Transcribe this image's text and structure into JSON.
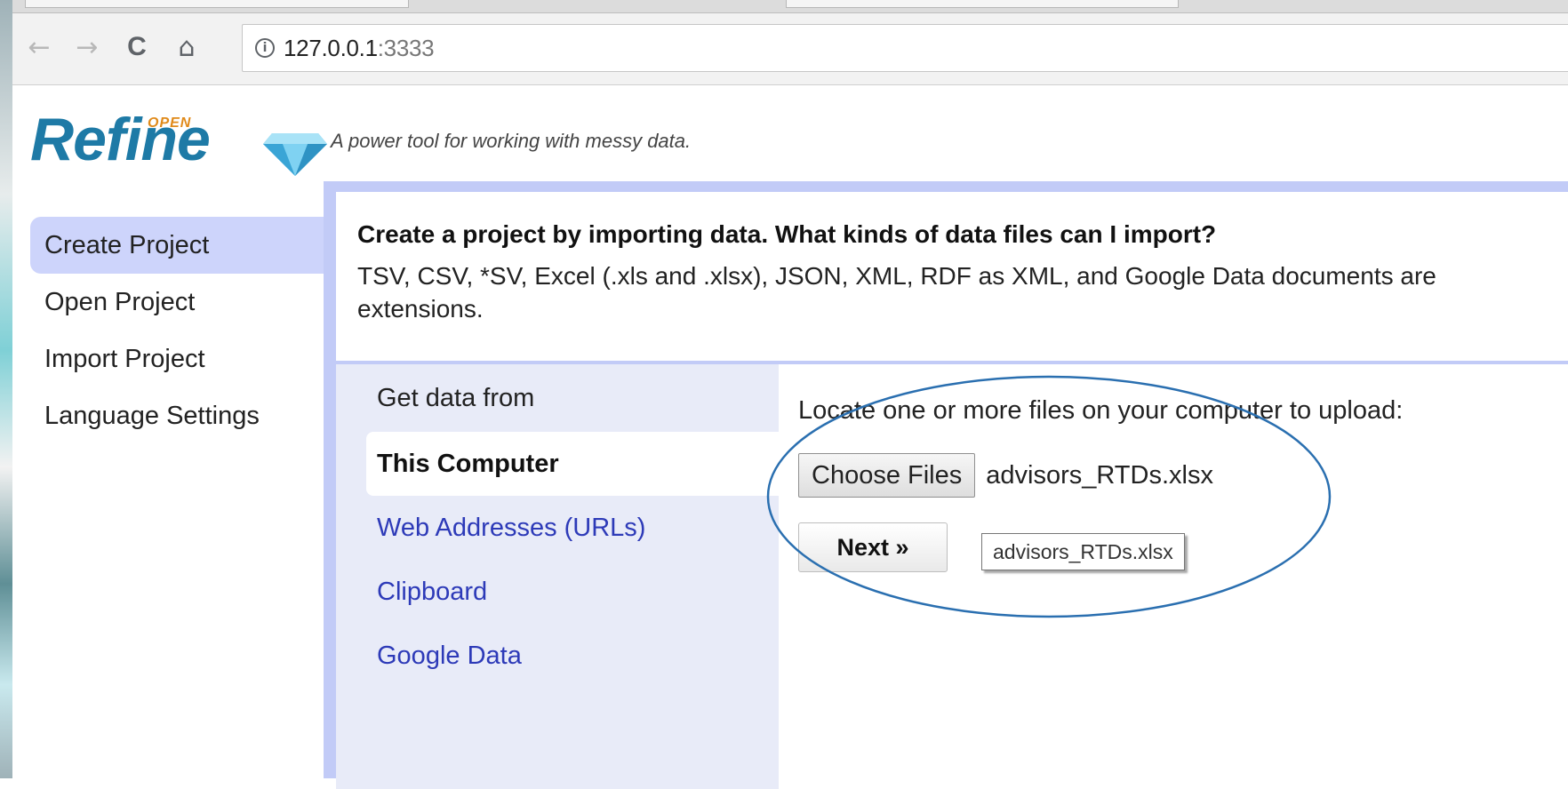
{
  "browser": {
    "back_icon": "←",
    "forward_icon": "→",
    "reload_icon": "C",
    "home_icon": "⌂",
    "url_host": "127.0.0.1",
    "url_port": ":3333"
  },
  "header": {
    "logo_text": "Refine",
    "logo_superscript": "OPEN",
    "tagline": "A power tool for working with messy data."
  },
  "left_nav": {
    "items": [
      {
        "label": "Create Project"
      },
      {
        "label": "Open Project"
      },
      {
        "label": "Import Project"
      },
      {
        "label": "Language Settings"
      }
    ]
  },
  "main": {
    "title": "Create a project by importing data. What kinds of data files can I import?",
    "description": "TSV, CSV, *SV, Excel (.xls and .xlsx), JSON, XML, RDF as XML, and Google Data documents are\nextensions."
  },
  "sources": {
    "heading": "Get data from",
    "items": [
      {
        "label": "This Computer"
      },
      {
        "label": "Web Addresses (URLs)"
      },
      {
        "label": "Clipboard"
      },
      {
        "label": "Google Data"
      }
    ]
  },
  "upload": {
    "prompt": "Locate one or more files on your computer to upload:",
    "choose_label": "Choose Files",
    "file_name": "advisors_RTDs.xlsx",
    "next_label": "Next »",
    "tooltip": "advisors_RTDs.xlsx"
  },
  "colors": {
    "accent_panel": "#c2cbf7",
    "active_nav": "#cdd4fb",
    "link": "#2d3ab8",
    "annotation": "#2a6fb0"
  }
}
